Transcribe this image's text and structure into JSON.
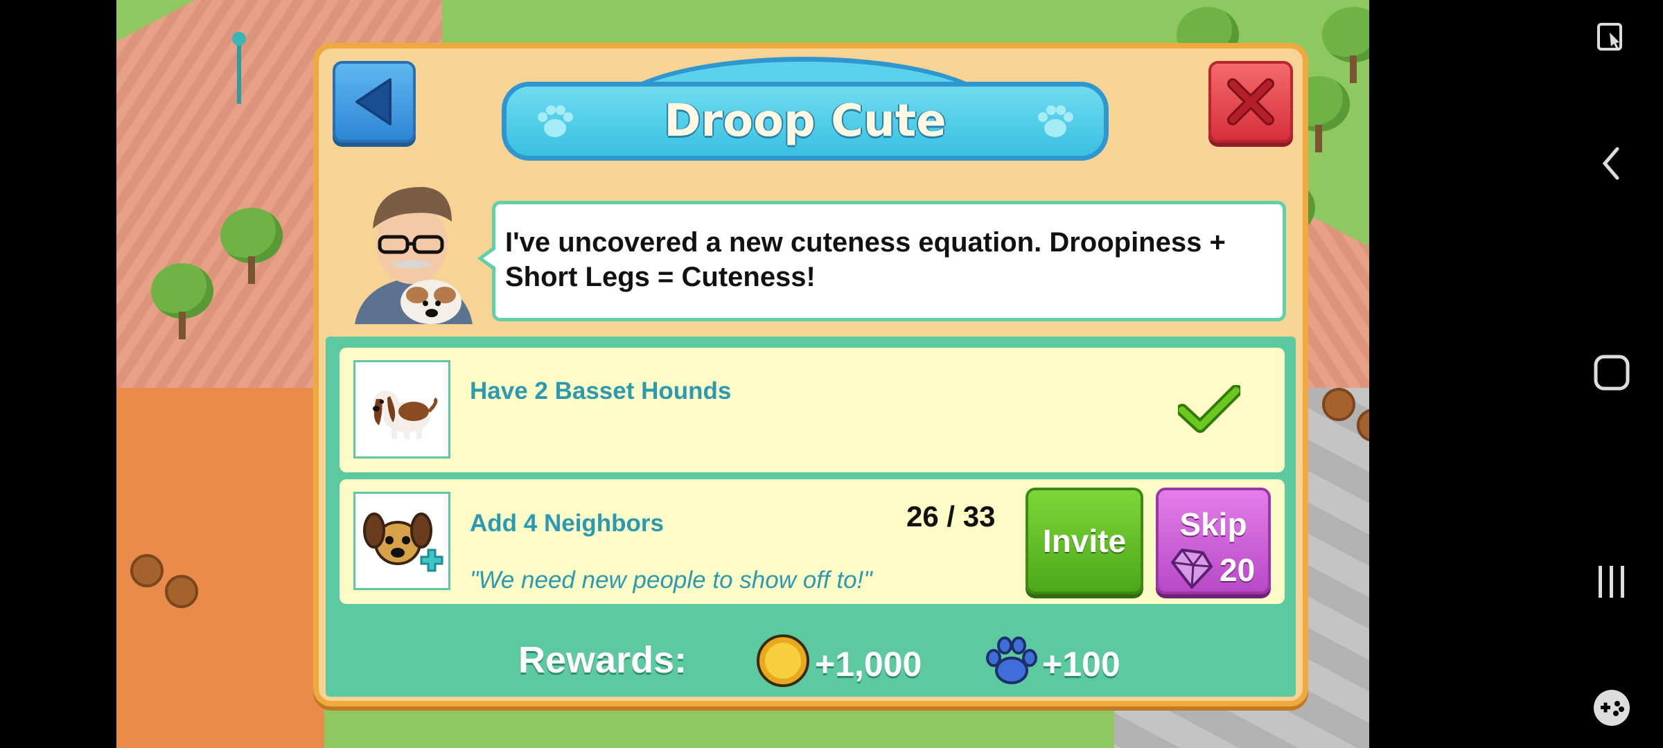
{
  "dialog": {
    "title": "Droop Cute",
    "speech": "I've uncovered a new cuteness equation. Droopiness + Short Legs = Cuteness!",
    "tasks": [
      {
        "title": "Have 2 Basset Hounds",
        "icon": "basset-hound-icon",
        "completed": true
      },
      {
        "title": "Add 4 Neighbors",
        "icon": "dog-add-icon",
        "progress": "26 / 33",
        "quote": "\"We need new people to show off to!\"",
        "invite_label": "Invite",
        "skip_label": "Skip",
        "skip_cost": "20"
      }
    ],
    "rewards": {
      "label": "Rewards:",
      "coins": "+1,000",
      "paws": "+100"
    }
  },
  "colors": {
    "dialog_bg": "#f8d494",
    "title_banner": "#39c0e0",
    "panel": "#5dc9a0",
    "task_text": "#2b9ab0",
    "invite": "#4ba818",
    "skip": "#b849c8",
    "close": "#d6303a",
    "back": "#2f86d4"
  },
  "system_nav": {
    "icons": [
      "screen-assist-icon",
      "back-arrow-icon",
      "home-icon",
      "recent-apps-icon",
      "game-launcher-icon"
    ]
  }
}
